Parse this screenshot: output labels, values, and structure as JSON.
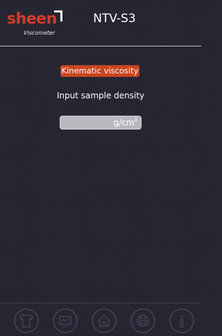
{
  "header": {
    "logo_text": "sheen",
    "logo_sub": "Viscometer",
    "title": "NTV-S3"
  },
  "main": {
    "mode_label": "Kinematic viscosity",
    "prompt": "Input sample density",
    "density_field": {
      "value": "",
      "unit": "g/cm",
      "unit_exponent": "3"
    }
  },
  "nav": {
    "items": [
      "shirt-icon",
      "display-icon",
      "home-icon",
      "globe-icon",
      "info-icon"
    ]
  },
  "colors": {
    "background": "#262633",
    "accent": "#c9441f",
    "brand": "#d93a2a",
    "field": "#b8b8be"
  }
}
